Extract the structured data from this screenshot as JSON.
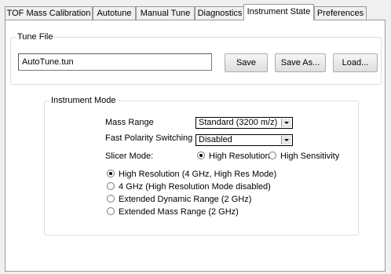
{
  "tabs": [
    {
      "label": "TOF Mass Calibration"
    },
    {
      "label": "Autotune"
    },
    {
      "label": "Manual Tune"
    },
    {
      "label": "Diagnostics"
    },
    {
      "label": "Instrument State"
    },
    {
      "label": "Preferences"
    }
  ],
  "active_tab": "Instrument State",
  "tune_file": {
    "group_label": "Tune File",
    "filename": "AutoTune.tun",
    "save_label": "Save",
    "save_as_label": "Save As...",
    "load_label": "Load..."
  },
  "instrument_mode": {
    "group_label": "Instrument Mode",
    "mass_range": {
      "label": "Mass Range",
      "value": "Standard (3200 m/z)"
    },
    "fast_polarity": {
      "label": "Fast Polarity Switching",
      "value": "Disabled"
    },
    "slicer_mode": {
      "label": "Slicer Mode:",
      "options": [
        {
          "label": "High Resolution",
          "selected": true
        },
        {
          "label": "High Sensitivity",
          "selected": false
        }
      ]
    },
    "modes": [
      {
        "label": "High Resolution (4 GHz, High Res Mode)",
        "selected": true
      },
      {
        "label": "4 GHz (High Resolution Mode disabled)",
        "selected": false
      },
      {
        "label": "Extended Dynamic Range (2 GHz)",
        "selected": false
      },
      {
        "label": "Extended Mass Range (2 GHz)",
        "selected": false
      }
    ]
  }
}
